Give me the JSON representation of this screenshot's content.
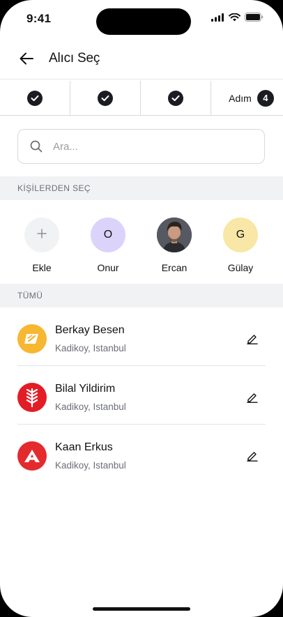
{
  "status_bar": {
    "time": "9:41"
  },
  "header": {
    "title": "Alıcı Seç",
    "back_icon": "arrow-left-icon"
  },
  "stepper": {
    "completed_steps": 3,
    "current_label": "Adım",
    "current_number": "4"
  },
  "search": {
    "placeholder": "Ara..."
  },
  "sections": {
    "contacts_title": "KİŞİLERDEN SEÇ",
    "all_title": "TÜMÜ"
  },
  "contacts": [
    {
      "name": "Ekle",
      "initial": "+",
      "bg": "#f1f2f4",
      "type": "add"
    },
    {
      "name": "Onur",
      "initial": "O",
      "bg": "#dcd3fb",
      "type": "initial"
    },
    {
      "name": "Ercan",
      "initial": "",
      "bg": "#3b3f45",
      "type": "photo"
    },
    {
      "name": "Gülay",
      "initial": "G",
      "bg": "#f8e7a6",
      "type": "initial"
    }
  ],
  "recipients": [
    {
      "name": "Berkay Besen",
      "location": "Kadikoy, Istanbul",
      "logo_color": "#f7b731",
      "logo": "card-icon"
    },
    {
      "name": "Bilal Yildirim",
      "location": "Kadikoy, Istanbul",
      "logo_color": "#e21d26",
      "logo": "wheat-icon"
    },
    {
      "name": "Kaan Erkus",
      "location": "Kadikoy, Istanbul",
      "logo_color": "#e42a2d",
      "logo": "letter-a-icon"
    }
  ]
}
